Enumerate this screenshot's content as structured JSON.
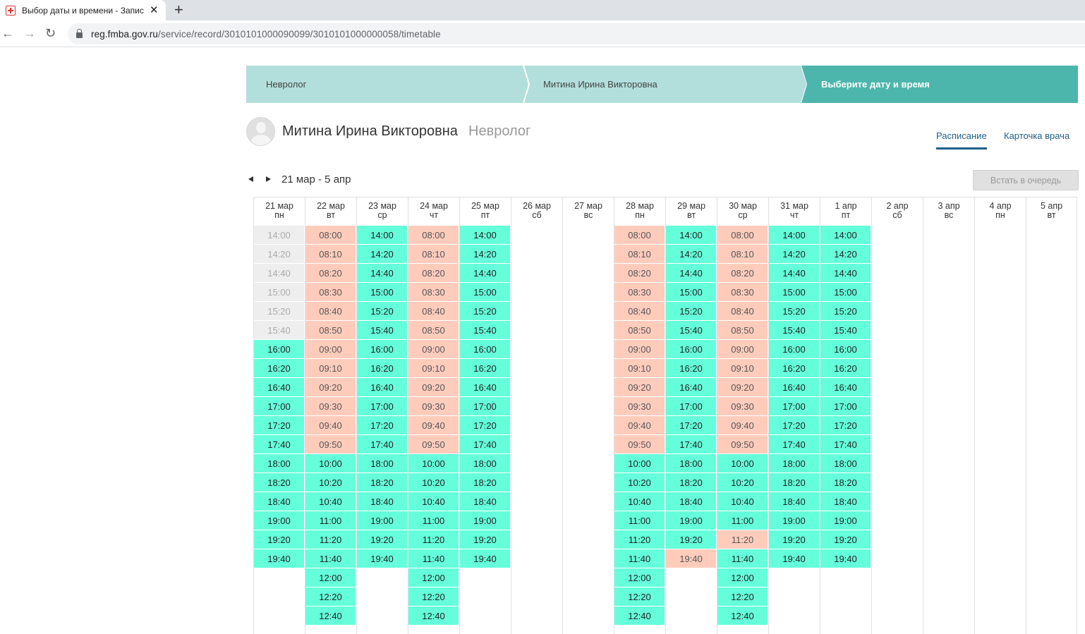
{
  "browser": {
    "tab_title": "Выбор даты и времени - Запис",
    "url_host": "reg.fmba.gov.ru",
    "url_path": "/service/record/3010101000090099/3010101000000058/timetable"
  },
  "breadcrumb": [
    "Невролог",
    "Митина Ирина Викторовна",
    "Выберите дату и время"
  ],
  "doctor": {
    "name": "Митина Ирина Викторовна",
    "specialty": "Невролог"
  },
  "tabs": {
    "schedule": "Расписание",
    "card": "Карточка врача"
  },
  "week_range": "21 мар - 5 апр",
  "queue_button": "Встать в очередь",
  "colors": {
    "free": "#64ffda",
    "busy": "#ffccbc",
    "past": "#eeeeee",
    "accent": "#4db6ac",
    "crumb": "#b2dfdb"
  },
  "days": [
    {
      "date": "21 мар",
      "dow": "пн",
      "slots": [
        [
          "14:00",
          "past"
        ],
        [
          "14:20",
          "past"
        ],
        [
          "14:40",
          "past"
        ],
        [
          "15:00",
          "past"
        ],
        [
          "15:20",
          "past"
        ],
        [
          "15:40",
          "past"
        ],
        [
          "16:00",
          "free"
        ],
        [
          "16:20",
          "free"
        ],
        [
          "16:40",
          "free"
        ],
        [
          "17:00",
          "free"
        ],
        [
          "17:20",
          "free"
        ],
        [
          "17:40",
          "free"
        ],
        [
          "18:00",
          "free"
        ],
        [
          "18:20",
          "free"
        ],
        [
          "18:40",
          "free"
        ],
        [
          "19:00",
          "free"
        ],
        [
          "19:20",
          "free"
        ],
        [
          "19:40",
          "free"
        ]
      ]
    },
    {
      "date": "22 мар",
      "dow": "вт",
      "slots": [
        [
          "08:00",
          "busy"
        ],
        [
          "08:10",
          "busy"
        ],
        [
          "08:20",
          "busy"
        ],
        [
          "08:30",
          "busy"
        ],
        [
          "08:40",
          "busy"
        ],
        [
          "08:50",
          "busy"
        ],
        [
          "09:00",
          "busy"
        ],
        [
          "09:10",
          "busy"
        ],
        [
          "09:20",
          "busy"
        ],
        [
          "09:30",
          "busy"
        ],
        [
          "09:40",
          "busy"
        ],
        [
          "09:50",
          "busy"
        ],
        [
          "10:00",
          "free"
        ],
        [
          "10:20",
          "free"
        ],
        [
          "10:40",
          "free"
        ],
        [
          "11:00",
          "free"
        ],
        [
          "11:20",
          "free"
        ],
        [
          "11:40",
          "free"
        ],
        [
          "12:00",
          "free"
        ],
        [
          "12:20",
          "free"
        ],
        [
          "12:40",
          "free"
        ]
      ]
    },
    {
      "date": "23 мар",
      "dow": "ср",
      "slots": [
        [
          "14:00",
          "free"
        ],
        [
          "14:20",
          "free"
        ],
        [
          "14:40",
          "free"
        ],
        [
          "15:00",
          "free"
        ],
        [
          "15:20",
          "free"
        ],
        [
          "15:40",
          "free"
        ],
        [
          "16:00",
          "free"
        ],
        [
          "16:20",
          "free"
        ],
        [
          "16:40",
          "free"
        ],
        [
          "17:00",
          "free"
        ],
        [
          "17:20",
          "free"
        ],
        [
          "17:40",
          "free"
        ],
        [
          "18:00",
          "free"
        ],
        [
          "18:20",
          "free"
        ],
        [
          "18:40",
          "free"
        ],
        [
          "19:00",
          "free"
        ],
        [
          "19:20",
          "free"
        ],
        [
          "19:40",
          "free"
        ]
      ]
    },
    {
      "date": "24 мар",
      "dow": "чт",
      "slots": [
        [
          "08:00",
          "busy"
        ],
        [
          "08:10",
          "busy"
        ],
        [
          "08:20",
          "busy"
        ],
        [
          "08:30",
          "busy"
        ],
        [
          "08:40",
          "busy"
        ],
        [
          "08:50",
          "busy"
        ],
        [
          "09:00",
          "busy"
        ],
        [
          "09:10",
          "busy"
        ],
        [
          "09:20",
          "busy"
        ],
        [
          "09:30",
          "busy"
        ],
        [
          "09:40",
          "busy"
        ],
        [
          "09:50",
          "busy"
        ],
        [
          "10:00",
          "free"
        ],
        [
          "10:20",
          "free"
        ],
        [
          "10:40",
          "free"
        ],
        [
          "11:00",
          "free"
        ],
        [
          "11:20",
          "free"
        ],
        [
          "11:40",
          "free"
        ],
        [
          "12:00",
          "free"
        ],
        [
          "12:20",
          "free"
        ],
        [
          "12:40",
          "free"
        ]
      ]
    },
    {
      "date": "25 мар",
      "dow": "пт",
      "slots": [
        [
          "14:00",
          "free"
        ],
        [
          "14:20",
          "free"
        ],
        [
          "14:40",
          "free"
        ],
        [
          "15:00",
          "free"
        ],
        [
          "15:20",
          "free"
        ],
        [
          "15:40",
          "free"
        ],
        [
          "16:00",
          "free"
        ],
        [
          "16:20",
          "free"
        ],
        [
          "16:40",
          "free"
        ],
        [
          "17:00",
          "free"
        ],
        [
          "17:20",
          "free"
        ],
        [
          "17:40",
          "free"
        ],
        [
          "18:00",
          "free"
        ],
        [
          "18:20",
          "free"
        ],
        [
          "18:40",
          "free"
        ],
        [
          "19:00",
          "free"
        ],
        [
          "19:20",
          "free"
        ],
        [
          "19:40",
          "free"
        ]
      ]
    },
    {
      "date": "26 мар",
      "dow": "сб",
      "slots": []
    },
    {
      "date": "27 мар",
      "dow": "вс",
      "slots": []
    },
    {
      "date": "28 мар",
      "dow": "пн",
      "slots": [
        [
          "08:00",
          "busy"
        ],
        [
          "08:10",
          "busy"
        ],
        [
          "08:20",
          "busy"
        ],
        [
          "08:30",
          "busy"
        ],
        [
          "08:40",
          "busy"
        ],
        [
          "08:50",
          "busy"
        ],
        [
          "09:00",
          "busy"
        ],
        [
          "09:10",
          "busy"
        ],
        [
          "09:20",
          "busy"
        ],
        [
          "09:30",
          "busy"
        ],
        [
          "09:40",
          "busy"
        ],
        [
          "09:50",
          "busy"
        ],
        [
          "10:00",
          "free"
        ],
        [
          "10:20",
          "free"
        ],
        [
          "10:40",
          "free"
        ],
        [
          "11:00",
          "free"
        ],
        [
          "11:20",
          "free"
        ],
        [
          "11:40",
          "free"
        ],
        [
          "12:00",
          "free"
        ],
        [
          "12:20",
          "free"
        ],
        [
          "12:40",
          "free"
        ]
      ]
    },
    {
      "date": "29 мар",
      "dow": "вт",
      "slots": [
        [
          "14:00",
          "free"
        ],
        [
          "14:20",
          "free"
        ],
        [
          "14:40",
          "free"
        ],
        [
          "15:00",
          "free"
        ],
        [
          "15:20",
          "free"
        ],
        [
          "15:40",
          "free"
        ],
        [
          "16:00",
          "free"
        ],
        [
          "16:20",
          "free"
        ],
        [
          "16:40",
          "free"
        ],
        [
          "17:00",
          "free"
        ],
        [
          "17:20",
          "free"
        ],
        [
          "17:40",
          "free"
        ],
        [
          "18:00",
          "free"
        ],
        [
          "18:20",
          "free"
        ],
        [
          "18:40",
          "free"
        ],
        [
          "19:00",
          "free"
        ],
        [
          "19:20",
          "free"
        ],
        [
          "19:40",
          "busy"
        ]
      ]
    },
    {
      "date": "30 мар",
      "dow": "ср",
      "slots": [
        [
          "08:00",
          "busy"
        ],
        [
          "08:10",
          "busy"
        ],
        [
          "08:20",
          "busy"
        ],
        [
          "08:30",
          "busy"
        ],
        [
          "08:40",
          "busy"
        ],
        [
          "08:50",
          "busy"
        ],
        [
          "09:00",
          "busy"
        ],
        [
          "09:10",
          "busy"
        ],
        [
          "09:20",
          "busy"
        ],
        [
          "09:30",
          "busy"
        ],
        [
          "09:40",
          "busy"
        ],
        [
          "09:50",
          "busy"
        ],
        [
          "10:00",
          "free"
        ],
        [
          "10:20",
          "free"
        ],
        [
          "10:40",
          "free"
        ],
        [
          "11:00",
          "free"
        ],
        [
          "11:20",
          "busy"
        ],
        [
          "11:40",
          "free"
        ],
        [
          "12:00",
          "free"
        ],
        [
          "12:20",
          "free"
        ],
        [
          "12:40",
          "free"
        ]
      ]
    },
    {
      "date": "31 мар",
      "dow": "чт",
      "slots": [
        [
          "14:00",
          "free"
        ],
        [
          "14:20",
          "free"
        ],
        [
          "14:40",
          "free"
        ],
        [
          "15:00",
          "free"
        ],
        [
          "15:20",
          "free"
        ],
        [
          "15:40",
          "free"
        ],
        [
          "16:00",
          "free"
        ],
        [
          "16:20",
          "free"
        ],
        [
          "16:40",
          "free"
        ],
        [
          "17:00",
          "free"
        ],
        [
          "17:20",
          "free"
        ],
        [
          "17:40",
          "free"
        ],
        [
          "18:00",
          "free"
        ],
        [
          "18:20",
          "free"
        ],
        [
          "18:40",
          "free"
        ],
        [
          "19:00",
          "free"
        ],
        [
          "19:20",
          "free"
        ],
        [
          "19:40",
          "free"
        ]
      ]
    },
    {
      "date": "1 апр",
      "dow": "пт",
      "slots": [
        [
          "14:00",
          "free"
        ],
        [
          "14:20",
          "free"
        ],
        [
          "14:40",
          "free"
        ],
        [
          "15:00",
          "free"
        ],
        [
          "15:20",
          "free"
        ],
        [
          "15:40",
          "free"
        ],
        [
          "16:00",
          "free"
        ],
        [
          "16:20",
          "free"
        ],
        [
          "16:40",
          "free"
        ],
        [
          "17:00",
          "free"
        ],
        [
          "17:20",
          "free"
        ],
        [
          "17:40",
          "free"
        ],
        [
          "18:00",
          "free"
        ],
        [
          "18:20",
          "free"
        ],
        [
          "18:40",
          "free"
        ],
        [
          "19:00",
          "free"
        ],
        [
          "19:20",
          "free"
        ],
        [
          "19:40",
          "free"
        ]
      ]
    },
    {
      "date": "2 апр",
      "dow": "сб",
      "slots": []
    },
    {
      "date": "3 апр",
      "dow": "вс",
      "slots": []
    },
    {
      "date": "4 апр",
      "dow": "пн",
      "slots": []
    },
    {
      "date": "5 апр",
      "dow": "вт",
      "slots": []
    }
  ]
}
